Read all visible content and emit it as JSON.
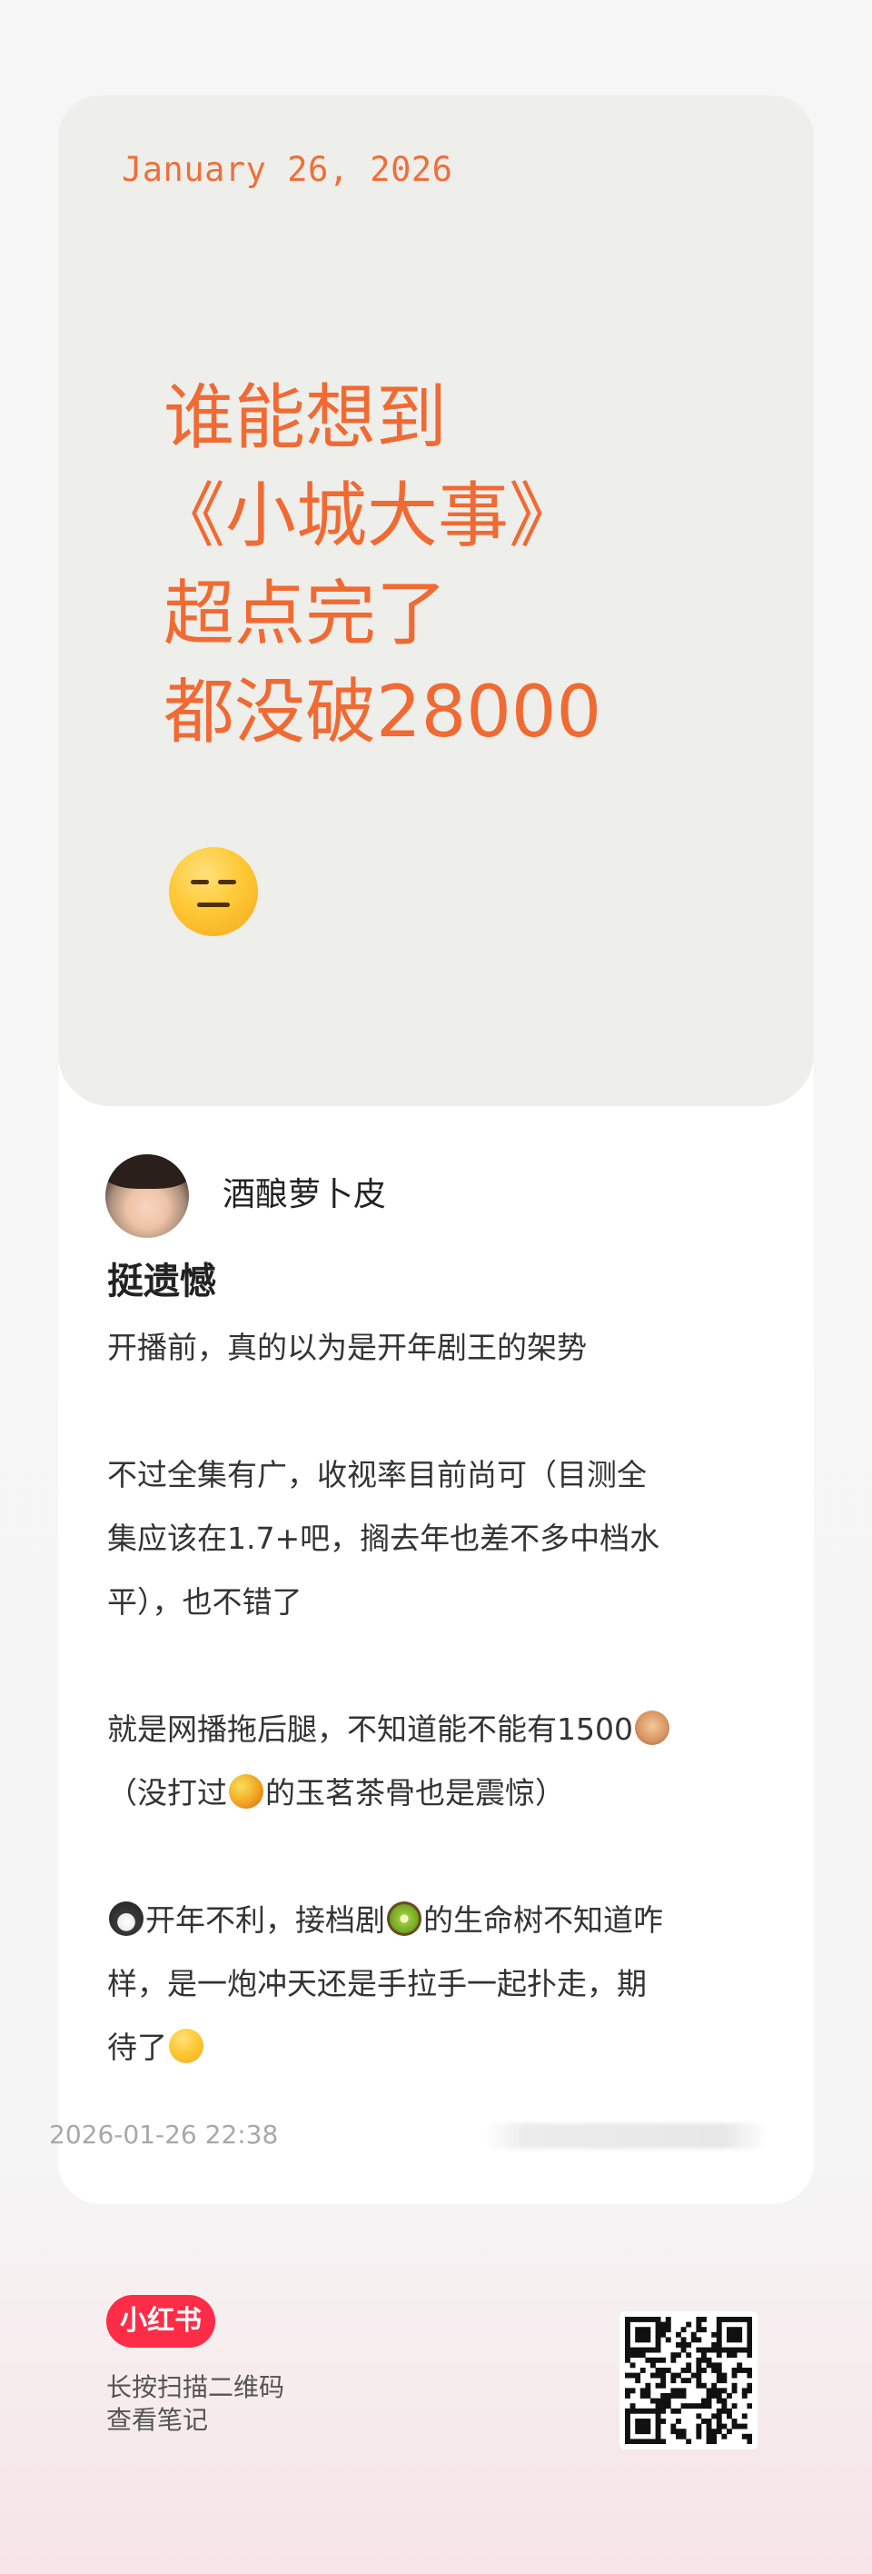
{
  "cover": {
    "date": "January 26, 2026",
    "headline_lines": [
      "谁能想到",
      "《小城大事》",
      "超点完了",
      "都没破28000"
    ],
    "emoji": "expressionless-face"
  },
  "author": {
    "name": "酒酿萝卜皮"
  },
  "post": {
    "title": "挺遗憾",
    "body": {
      "p1": "开播前，真的以为是开年剧王的架势",
      "p2_l1": "不过全集有广，收视率目前尚可（目测全",
      "p2_l2": "集应该在1.7+吧，搁去年也差不多中档水",
      "p2_l3": "平），也不错了",
      "p3_l1": "就是网播拖后腿，不知道能不能有1500",
      "p3_l2a": "（没打过",
      "p3_l2b": "的玉茗茶骨也是震惊）",
      "p4_l1a": "开年不利，接档剧",
      "p4_l1b": "的生命树不知道咋",
      "p4_l2": "样，是一炮冲天还是手拉手一起扑走，期",
      "p4_l3": "待了"
    },
    "date": "2026-01-26 22:38"
  },
  "footer": {
    "brand": "小红书",
    "scan_line1": "长按扫描二维码",
    "scan_line2": "查看笔记"
  },
  "colors": {
    "accent_orange": "#f06a33",
    "brand_red": "#fe2c46",
    "cover_bg": "#eeeeea"
  },
  "icons": [
    "see-no-evil-monkey-icon",
    "mango-icon",
    "penguin-icon",
    "kiwi-icon",
    "thinking-face-icon",
    "qr-code-icon"
  ]
}
